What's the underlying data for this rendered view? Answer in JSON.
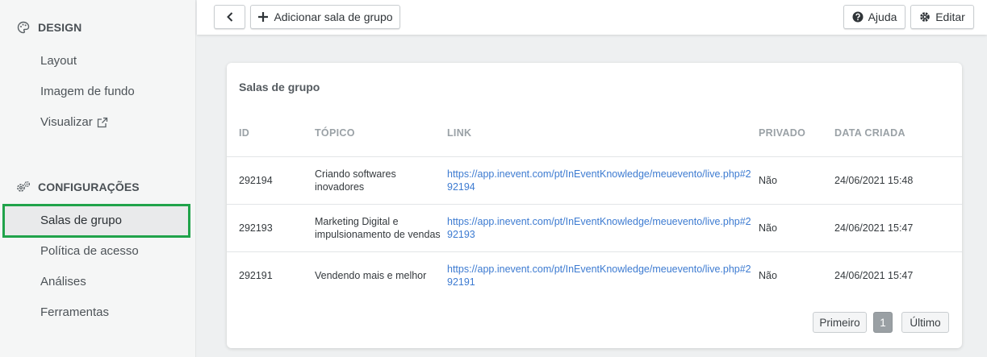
{
  "sidebar": {
    "design": {
      "title": "DESIGN",
      "icon": "palette-icon",
      "items": [
        {
          "label": "Layout"
        },
        {
          "label": "Imagem de fundo"
        },
        {
          "label": "Visualizar",
          "icon": "external-link-icon"
        }
      ]
    },
    "config": {
      "title": "CONFIGURAÇÕES",
      "icon": "gears-icon",
      "items": [
        {
          "label": "Salas de grupo",
          "active": true
        },
        {
          "label": "Política de acesso"
        },
        {
          "label": "Análises"
        },
        {
          "label": "Ferramentas"
        }
      ]
    }
  },
  "toolbar": {
    "back_icon": "chevron-left-icon",
    "add_label": "Adicionar sala de grupo",
    "help_label": "Ajuda",
    "edit_label": "Editar"
  },
  "card": {
    "title": "Salas de grupo",
    "columns": [
      "ID",
      "TÓPICO",
      "LINK",
      "PRIVADO",
      "DATA CRIADA"
    ],
    "rows": [
      {
        "id": "292194",
        "topic_l1": "Criando softwares",
        "topic_l2": "inovadores",
        "link_l1": "https://app.inevent.com/pt/InEventKnowledge/meuevento/live.php#2",
        "link_l2": "92194",
        "private": "Não",
        "date": "24/06/2021 15:48"
      },
      {
        "id": "292193",
        "topic_l1": "Marketing Digital e",
        "topic_l2": "impulsionamento de vendas",
        "link_l1": "https://app.inevent.com/pt/InEventKnowledge/meuevento/live.php#2",
        "link_l2": "92193",
        "private": "Não",
        "date": "24/06/2021 15:47"
      },
      {
        "id": "292191",
        "topic_l1": "Vendendo mais e melhor",
        "topic_l2": "",
        "link_l1": "https://app.inevent.com/pt/InEventKnowledge/meuevento/live.php#2",
        "link_l2": "92191",
        "private": "Não",
        "date": "24/06/2021 15:47"
      }
    ]
  },
  "pager": {
    "first": "Primeiro",
    "current": "1",
    "last": "Último"
  },
  "colors": {
    "active_border": "#20a34a",
    "link": "#3d7bd1"
  }
}
